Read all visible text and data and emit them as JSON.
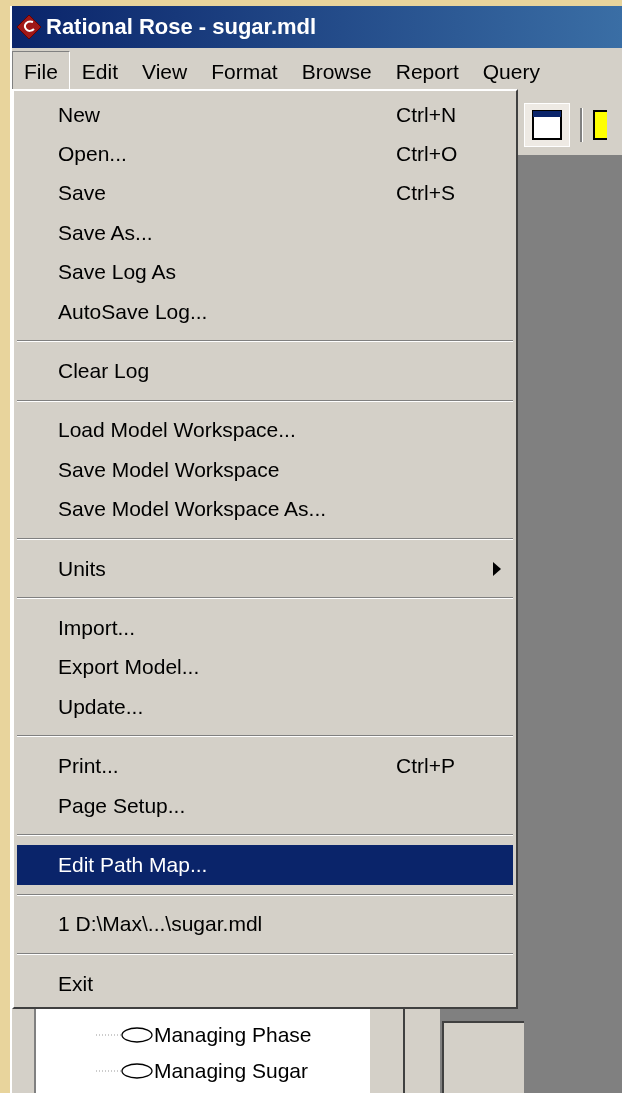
{
  "window": {
    "title": "Rational Rose - sugar.mdl"
  },
  "menu_bar": [
    {
      "label": "File",
      "selected": true
    },
    {
      "label": "Edit",
      "selected": false
    },
    {
      "label": "View",
      "selected": false
    },
    {
      "label": "Format",
      "selected": false
    },
    {
      "label": "Browse",
      "selected": false
    },
    {
      "label": "Report",
      "selected": false
    },
    {
      "label": "Query",
      "selected": false
    }
  ],
  "file_menu": [
    [
      {
        "label": "New",
        "shortcut": "Ctrl+N",
        "selected": false
      },
      {
        "label": "Open...",
        "shortcut": "Ctrl+O",
        "selected": false
      },
      {
        "label": "Save",
        "shortcut": "Ctrl+S",
        "selected": false
      },
      {
        "label": "Save As...",
        "selected": false
      },
      {
        "label": "Save Log As",
        "selected": false
      },
      {
        "label": "AutoSave Log...",
        "selected": false
      }
    ],
    [
      {
        "label": "Clear Log",
        "selected": false
      }
    ],
    [
      {
        "label": "Load Model Workspace...",
        "selected": false
      },
      {
        "label": "Save Model Workspace",
        "selected": false
      },
      {
        "label": "Save Model Workspace As...",
        "selected": false
      }
    ],
    [
      {
        "label": "Units",
        "submenu": true,
        "selected": false
      }
    ],
    [
      {
        "label": "Import...",
        "selected": false
      },
      {
        "label": "Export Model...",
        "selected": false
      },
      {
        "label": "Update...",
        "selected": false
      }
    ],
    [
      {
        "label": "Print...",
        "shortcut": "Ctrl+P",
        "selected": false
      },
      {
        "label": "Page Setup...",
        "selected": false
      }
    ],
    [
      {
        "label": "Edit Path Map...",
        "selected": true
      }
    ],
    [
      {
        "label": "1 D:\\Max\\...\\sugar.mdl",
        "selected": false
      }
    ],
    [
      {
        "label": "Exit",
        "selected": false
      }
    ]
  ],
  "browser_tree": [
    {
      "label": "Managing Phase"
    },
    {
      "label": "Managing Sugar"
    }
  ]
}
